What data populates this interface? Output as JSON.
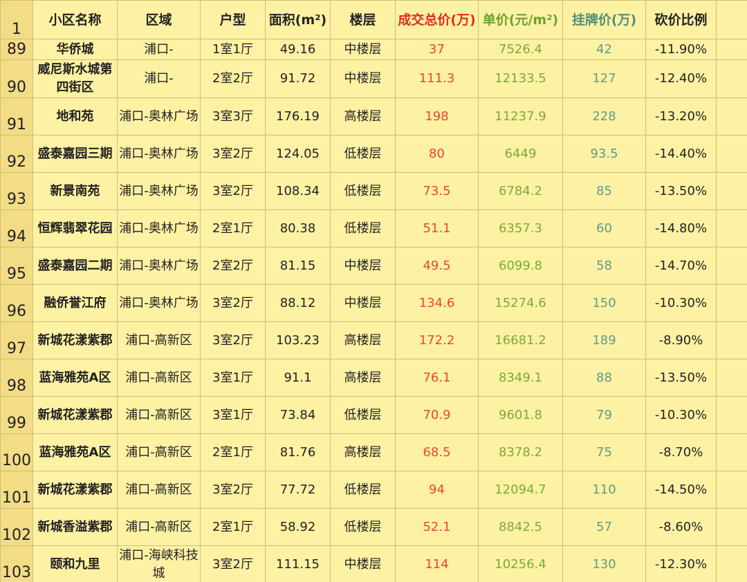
{
  "sheet": {
    "header_row_number": "1",
    "columns": [
      {
        "key": "name",
        "label": "小区名称",
        "color": "#222222"
      },
      {
        "key": "region",
        "label": "区域",
        "color": "#222222"
      },
      {
        "key": "layout",
        "label": "户型",
        "color": "#222222"
      },
      {
        "key": "area",
        "label": "面积(m²)",
        "color": "#222222"
      },
      {
        "key": "floor",
        "label": "楼层",
        "color": "#222222"
      },
      {
        "key": "total",
        "label": "成交总价(万)",
        "color": "#e32c1f"
      },
      {
        "key": "unit",
        "label": "单价(元/m²)",
        "color": "#6da232"
      },
      {
        "key": "list",
        "label": "挂牌价(万)",
        "color": "#4f8e79"
      },
      {
        "key": "cut",
        "label": "砍价比例",
        "color": "#222222"
      }
    ],
    "rows": [
      {
        "n": "89",
        "name": "华侨城",
        "region": "浦口-",
        "layout": "1室1厅",
        "area": "49.16",
        "floor": "中楼层",
        "total": "37",
        "unit": "7526.4",
        "list": "42",
        "cut": "-11.90%"
      },
      {
        "n": "90",
        "name": "威尼斯水城第四街区",
        "region": "浦口-",
        "layout": "2室2厅",
        "area": "91.72",
        "floor": "中楼层",
        "total": "111.3",
        "unit": "12133.5",
        "list": "127",
        "cut": "-12.40%"
      },
      {
        "n": "91",
        "name": "地和苑",
        "region": "浦口-奥林广场",
        "layout": "3室3厅",
        "area": "176.19",
        "floor": "高楼层",
        "total": "198",
        "unit": "11237.9",
        "list": "228",
        "cut": "-13.20%"
      },
      {
        "n": "92",
        "name": "盛泰嘉园三期",
        "region": "浦口-奥林广场",
        "layout": "3室2厅",
        "area": "124.05",
        "floor": "低楼层",
        "total": "80",
        "unit": "6449",
        "list": "93.5",
        "cut": "-14.40%"
      },
      {
        "n": "93",
        "name": "新景南苑",
        "region": "浦口-奥林广场",
        "layout": "3室2厅",
        "area": "108.34",
        "floor": "低楼层",
        "total": "73.5",
        "unit": "6784.2",
        "list": "85",
        "cut": "-13.50%"
      },
      {
        "n": "94",
        "name": "恒辉翡翠花园",
        "region": "浦口-奥林广场",
        "layout": "2室1厅",
        "area": "80.38",
        "floor": "低楼层",
        "total": "51.1",
        "unit": "6357.3",
        "list": "60",
        "cut": "-14.80%"
      },
      {
        "n": "95",
        "name": "盛泰嘉园二期",
        "region": "浦口-奥林广场",
        "layout": "2室2厅",
        "area": "81.15",
        "floor": "中楼层",
        "total": "49.5",
        "unit": "6099.8",
        "list": "58",
        "cut": "-14.70%"
      },
      {
        "n": "96",
        "name": "融侨誉江府",
        "region": "浦口-奥林广场",
        "layout": "3室2厅",
        "area": "88.12",
        "floor": "中楼层",
        "total": "134.6",
        "unit": "15274.6",
        "list": "150",
        "cut": "-10.30%"
      },
      {
        "n": "97",
        "name": "新城花漾紫郡",
        "region": "浦口-高新区",
        "layout": "3室2厅",
        "area": "103.23",
        "floor": "高楼层",
        "total": "172.2",
        "unit": "16681.2",
        "list": "189",
        "cut": "-8.90%"
      },
      {
        "n": "98",
        "name": "蓝海雅苑A区",
        "region": "浦口-高新区",
        "layout": "3室1厅",
        "area": "91.1",
        "floor": "高楼层",
        "total": "76.1",
        "unit": "8349.1",
        "list": "88",
        "cut": "-13.50%"
      },
      {
        "n": "99",
        "name": "新城花漾紫郡",
        "region": "浦口-高新区",
        "layout": "3室1厅",
        "area": "73.84",
        "floor": "低楼层",
        "total": "70.9",
        "unit": "9601.8",
        "list": "79",
        "cut": "-10.30%"
      },
      {
        "n": "100",
        "name": "蓝海雅苑A区",
        "region": "浦口-高新区",
        "layout": "2室1厅",
        "area": "81.76",
        "floor": "高楼层",
        "total": "68.5",
        "unit": "8378.2",
        "list": "75",
        "cut": "-8.70%"
      },
      {
        "n": "101",
        "name": "新城花漾紫郡",
        "region": "浦口-高新区",
        "layout": "3室2厅",
        "area": "77.72",
        "floor": "低楼层",
        "total": "94",
        "unit": "12094.7",
        "list": "110",
        "cut": "-14.50%"
      },
      {
        "n": "102",
        "name": "新城香溢紫郡",
        "region": "浦口-高新区",
        "layout": "2室1厅",
        "area": "58.92",
        "floor": "低楼层",
        "total": "52.1",
        "unit": "8842.5",
        "list": "57",
        "cut": "-8.60%"
      },
      {
        "n": "103",
        "name": "颐和九里",
        "region": "浦口-海峡科技城",
        "layout": "3室2厅",
        "area": "111.15",
        "floor": "中楼层",
        "total": "114",
        "unit": "10256.4",
        "list": "130",
        "cut": "-12.30%"
      }
    ]
  }
}
